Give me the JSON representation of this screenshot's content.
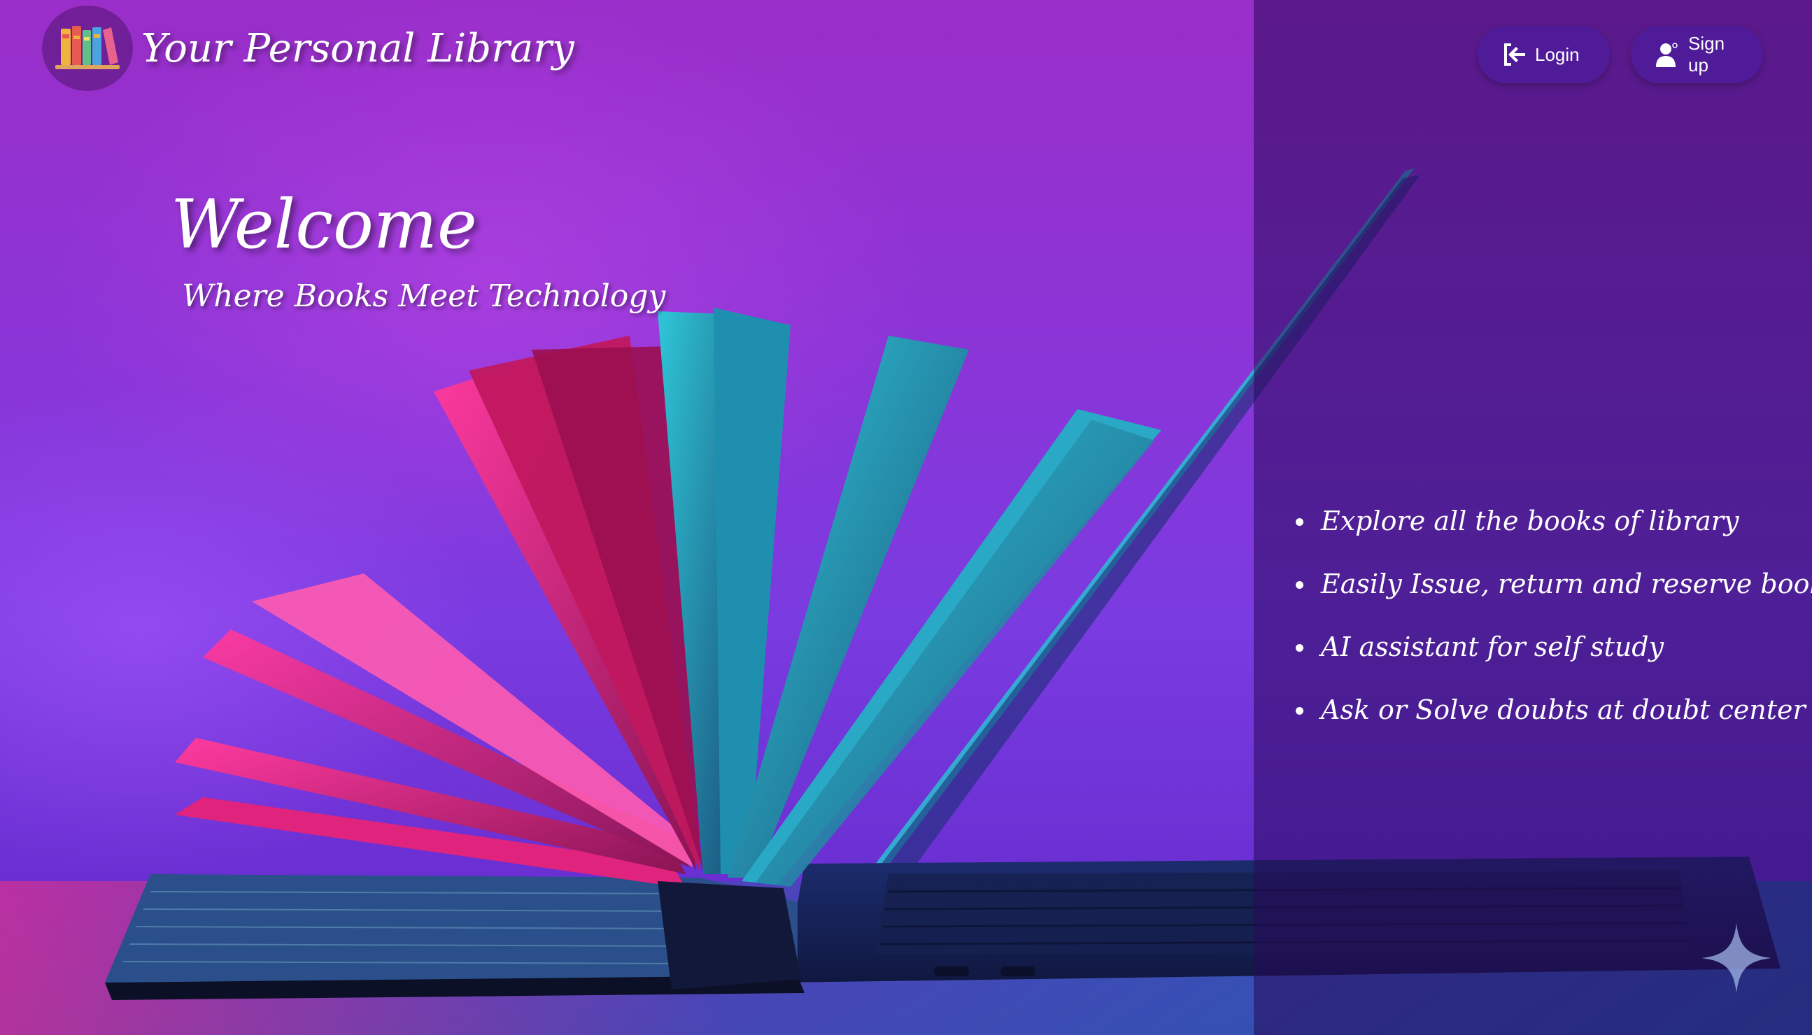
{
  "header": {
    "logo_icon": "bookshelf-icon",
    "title": "Your Personal Library"
  },
  "nav": {
    "login": {
      "label": "Login",
      "icon": "login-arrow-icon"
    },
    "signup": {
      "label": "Sign up",
      "icon": "user-add-icon"
    }
  },
  "hero": {
    "welcome": "Welcome",
    "tagline": "Where Books Meet Technology",
    "background": "open-book-and-laptop-photo"
  },
  "features": [
    "Explore all the books of library",
    "Easily Issue, return and reserve books.",
    "AI assistant for self study",
    "Ask or Solve doubts at doubt center"
  ],
  "colors": {
    "accent": "#4f1b99",
    "background_purple": "#8a35d8",
    "overlay": "#280a5a",
    "text": "#ffffff"
  },
  "corner_icon": "sparkle-icon"
}
